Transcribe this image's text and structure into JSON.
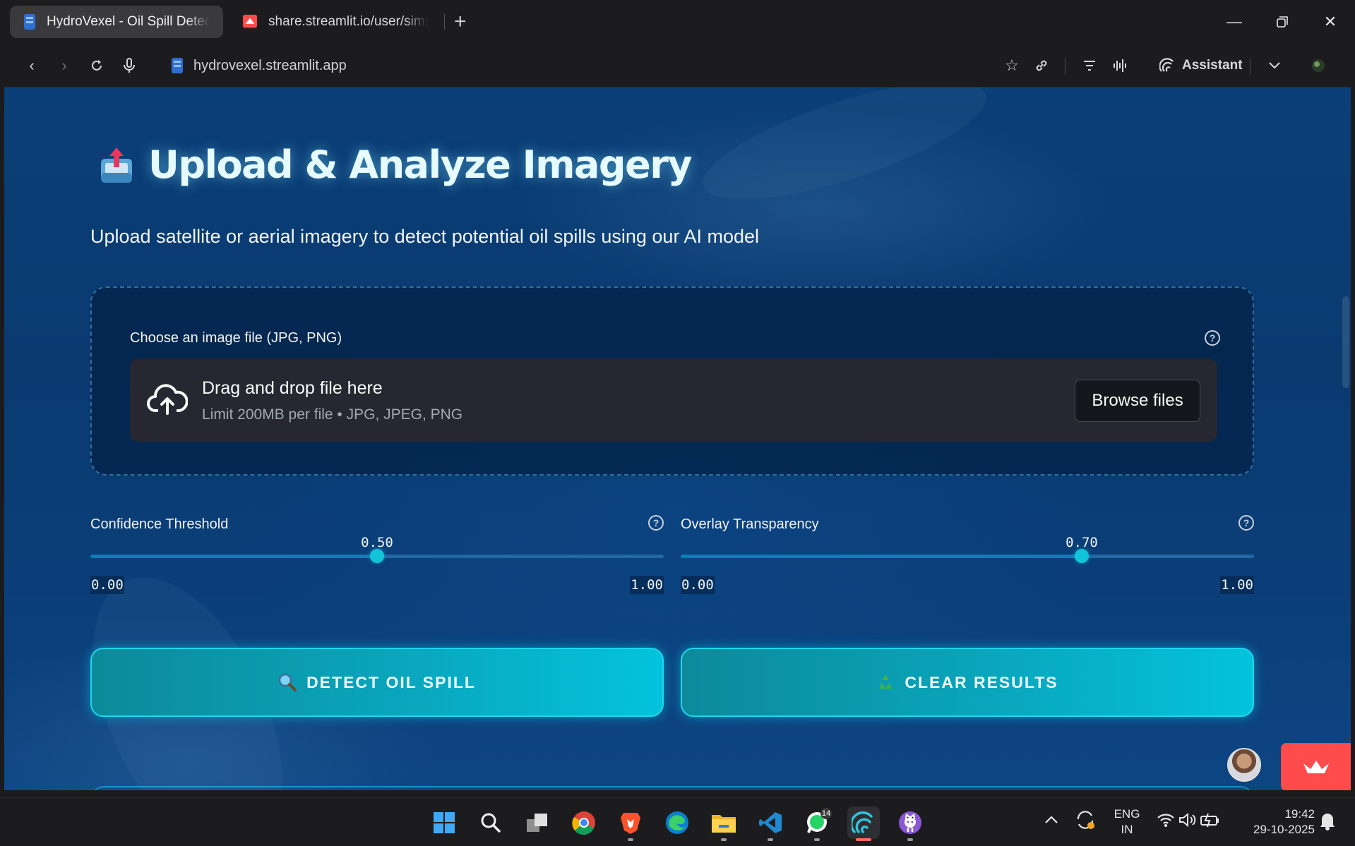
{
  "browser": {
    "tabs": [
      {
        "title": "HydroVexel - Oil Spill Detection",
        "active": true,
        "favicon": "hydrovexel-icon"
      },
      {
        "title": "share.streamlit.io/user/simplyalb",
        "active": false,
        "favicon": "streamlit-icon"
      }
    ],
    "new_tab_label": "+",
    "url": "hydrovexel.streamlit.app",
    "assistant_label": "Assistant"
  },
  "page": {
    "title": "Upload & Analyze Imagery",
    "title_icon": "inbox-tray-upload-icon",
    "subtitle": "Upload satellite or aerial imagery to detect potential oil spills using our AI model",
    "uploader": {
      "label": "Choose an image file (JPG, PNG)",
      "drop_title": "Drag and drop file here",
      "drop_limit": "Limit 200MB per file • JPG, JPEG, PNG",
      "browse_label": "Browse files"
    },
    "sliders": [
      {
        "label": "Confidence Threshold",
        "value": 0.5,
        "value_text": "0.50",
        "min_text": "0.00",
        "max_text": "1.00"
      },
      {
        "label": "Overlay Transparency",
        "value": 0.7,
        "value_text": "0.70",
        "min_text": "0.00",
        "max_text": "1.00"
      }
    ],
    "buttons": {
      "detect": {
        "label": "DETECT OIL SPILL",
        "icon": "magnifier-icon"
      },
      "clear": {
        "label": "CLEAR RESULTS",
        "icon": "recycle-icon"
      }
    }
  },
  "taskbar": {
    "apps": [
      "windows-start",
      "search",
      "task-view",
      "chrome",
      "brave",
      "edge",
      "file-explorer",
      "vscode",
      "whatsapp",
      "app-active",
      "github"
    ],
    "whatsapp_badge": "14",
    "language": {
      "line1": "ENG",
      "line2": "IN"
    },
    "clock": {
      "time": "19:42",
      "date": "29-10-2025"
    }
  },
  "colors": {
    "accent": "#12c3da",
    "page_bg": "#0b3f77",
    "streamlit_red": "#ff4b4b"
  }
}
